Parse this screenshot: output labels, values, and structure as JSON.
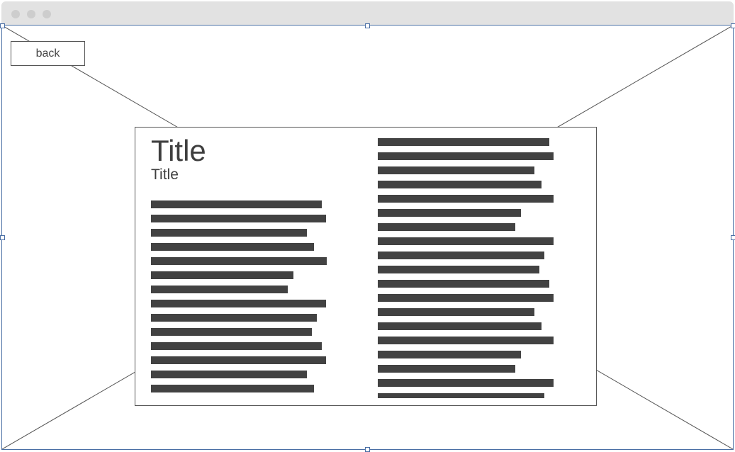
{
  "window": {
    "traffic_lights": [
      "close",
      "minimize",
      "zoom"
    ]
  },
  "navigation": {
    "back_label": "back"
  },
  "content": {
    "title": "Title",
    "subtitle": "Title",
    "left_column": {
      "line_count": 14,
      "line_fill": [
        0.971,
        0.995,
        0.887,
        0.927,
        1.0,
        0.81,
        0.778,
        0.995,
        0.944,
        0.915,
        0.971,
        0.995,
        0.887,
        0.927
      ]
    },
    "right_column": {
      "line_count": 19,
      "line_fill": [
        0.976,
        1.0,
        0.891,
        0.931,
        1.0,
        0.814,
        0.781,
        1.0,
        0.947,
        0.919,
        0.976,
        1.0,
        0.891,
        0.931,
        1.0,
        0.814,
        0.781,
        1.0,
        0.947
      ]
    }
  },
  "colors": {
    "text_bar": "#424242",
    "selection_border": "#4a6fa5",
    "titlebar": "#e2e2e2"
  }
}
